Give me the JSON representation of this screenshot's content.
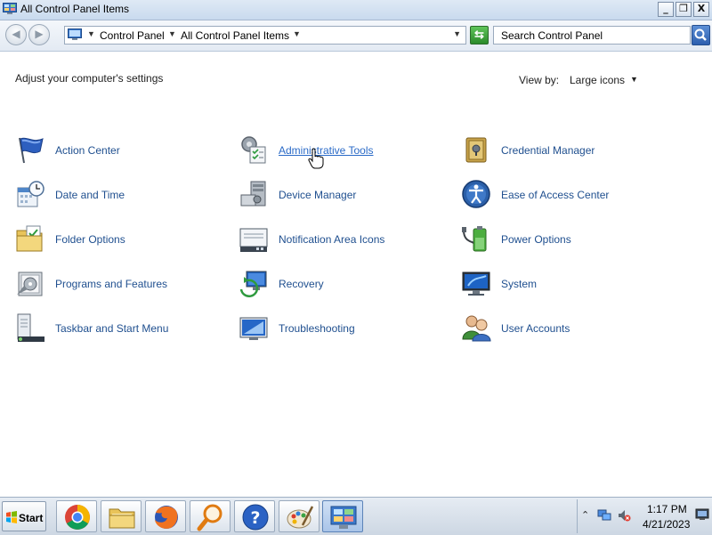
{
  "window": {
    "title": "All Control Panel Items",
    "controls": {
      "minimize": "_",
      "maximize": "❐",
      "close": "X"
    }
  },
  "address": {
    "crumbs": [
      "Control Panel",
      "All Control Panel Items"
    ],
    "search_placeholder": "Search Control Panel"
  },
  "content": {
    "heading": "Adjust your computer's settings",
    "view_by_label": "View by:",
    "view_by_value": "Large icons",
    "items": [
      {
        "label": "Action Center",
        "icon": "flag-icon"
      },
      {
        "label": "Administrative Tools",
        "icon": "admin-tools-icon",
        "hovered": true
      },
      {
        "label": "Credential Manager",
        "icon": "vault-icon"
      },
      {
        "label": "Date and Time",
        "icon": "calendar-clock-icon"
      },
      {
        "label": "Device Manager",
        "icon": "device-manager-icon"
      },
      {
        "label": "Ease of Access Center",
        "icon": "ease-of-access-icon"
      },
      {
        "label": "Folder Options",
        "icon": "folder-options-icon"
      },
      {
        "label": "Notification Area Icons",
        "icon": "notification-area-icon"
      },
      {
        "label": "Power Options",
        "icon": "battery-plug-icon"
      },
      {
        "label": "Programs and Features",
        "icon": "programs-icon"
      },
      {
        "label": "Recovery",
        "icon": "recovery-icon"
      },
      {
        "label": "System",
        "icon": "computer-monitor-icon"
      },
      {
        "label": "Taskbar and Start Menu",
        "icon": "taskbar-icon"
      },
      {
        "label": "Troubleshooting",
        "icon": "troubleshooting-icon"
      },
      {
        "label": "User Accounts",
        "icon": "users-icon"
      }
    ]
  },
  "taskbar": {
    "start_label": "Start",
    "apps": [
      "chrome-icon",
      "file-explorer-icon",
      "firefox-icon",
      "search-magnifier-icon",
      "help-icon",
      "paint-icon",
      "control-panel-icon"
    ],
    "time": "1:17 PM",
    "date": "4/21/2023"
  },
  "colors": {
    "link": "#1f4f8f",
    "link_hover": "#2a6ac7",
    "titlebar": "#c9daee"
  }
}
